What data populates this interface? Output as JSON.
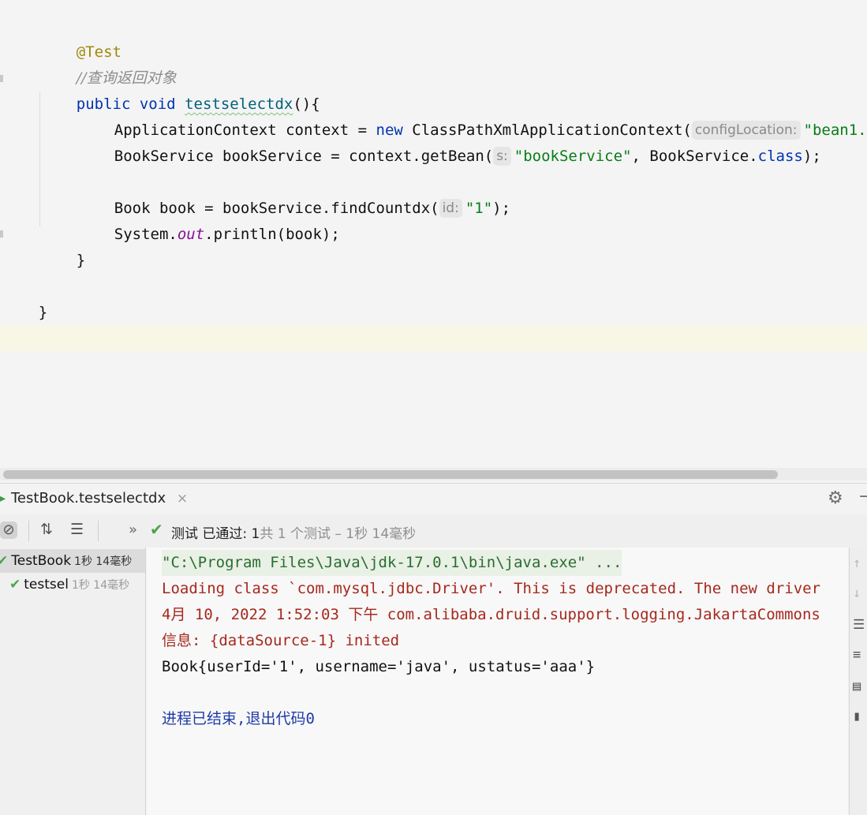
{
  "editor": {
    "lines": {
      "annotation": "@Test",
      "comment": "//查询返回对象",
      "sig_kw1": "public",
      "sig_kw2": "void",
      "sig_fn": "testselectdx",
      "sig_rest": "(){",
      "l4_a": "ApplicationContext context = ",
      "l4_kw": "new",
      "l4_b": " ClassPathXmlApplicationContext(",
      "l4_hint": "configLocation:",
      "l4_str": "\"bean1.",
      "l5_a": "BookService bookService = context.getBean(",
      "l5_hint": "s:",
      "l5_str": "\"bookService\"",
      "l5_b": ", BookService.",
      "l5_kw": "class",
      "l5_c": ");",
      "l7_a": "Book book = bookService.findCountdx(",
      "l7_hint": "id:",
      "l7_str": "\"1\"",
      "l7_b": ");",
      "l8_a": "System.",
      "l8_field": "out",
      "l8_b": ".println(book);",
      "close_method": "}",
      "close_class": "}"
    }
  },
  "run_panel": {
    "tab_title": "TestBook.testselectdx",
    "tab_close": "×",
    "status": {
      "main": "测试 已通过: 1",
      "sub": "共 1 个测试 – 1秒 14毫秒"
    },
    "tree": [
      {
        "name": "TestBook",
        "time": "1秒 14毫秒"
      },
      {
        "name": "testsel",
        "time": "1秒 14毫秒"
      }
    ],
    "console": [
      "\"C:\\Program Files\\Java\\jdk-17.0.1\\bin\\java.exe\" ...",
      "Loading class `com.mysql.jdbc.Driver'. This is deprecated. The new driver",
      "4月 10, 2022 1:52:03 下午 com.alibaba.druid.support.logging.JakartaCommons",
      "信息: {dataSource-1} inited",
      "Book{userId='1', username='java', ustatus='aaa'}",
      "进程已结束,退出代码0"
    ]
  },
  "colors": {
    "keyword": "#0033b3",
    "string": "#067d17",
    "annotation": "#9e880d",
    "pass_green": "#4aa54a",
    "error_red": "#a6281d"
  }
}
